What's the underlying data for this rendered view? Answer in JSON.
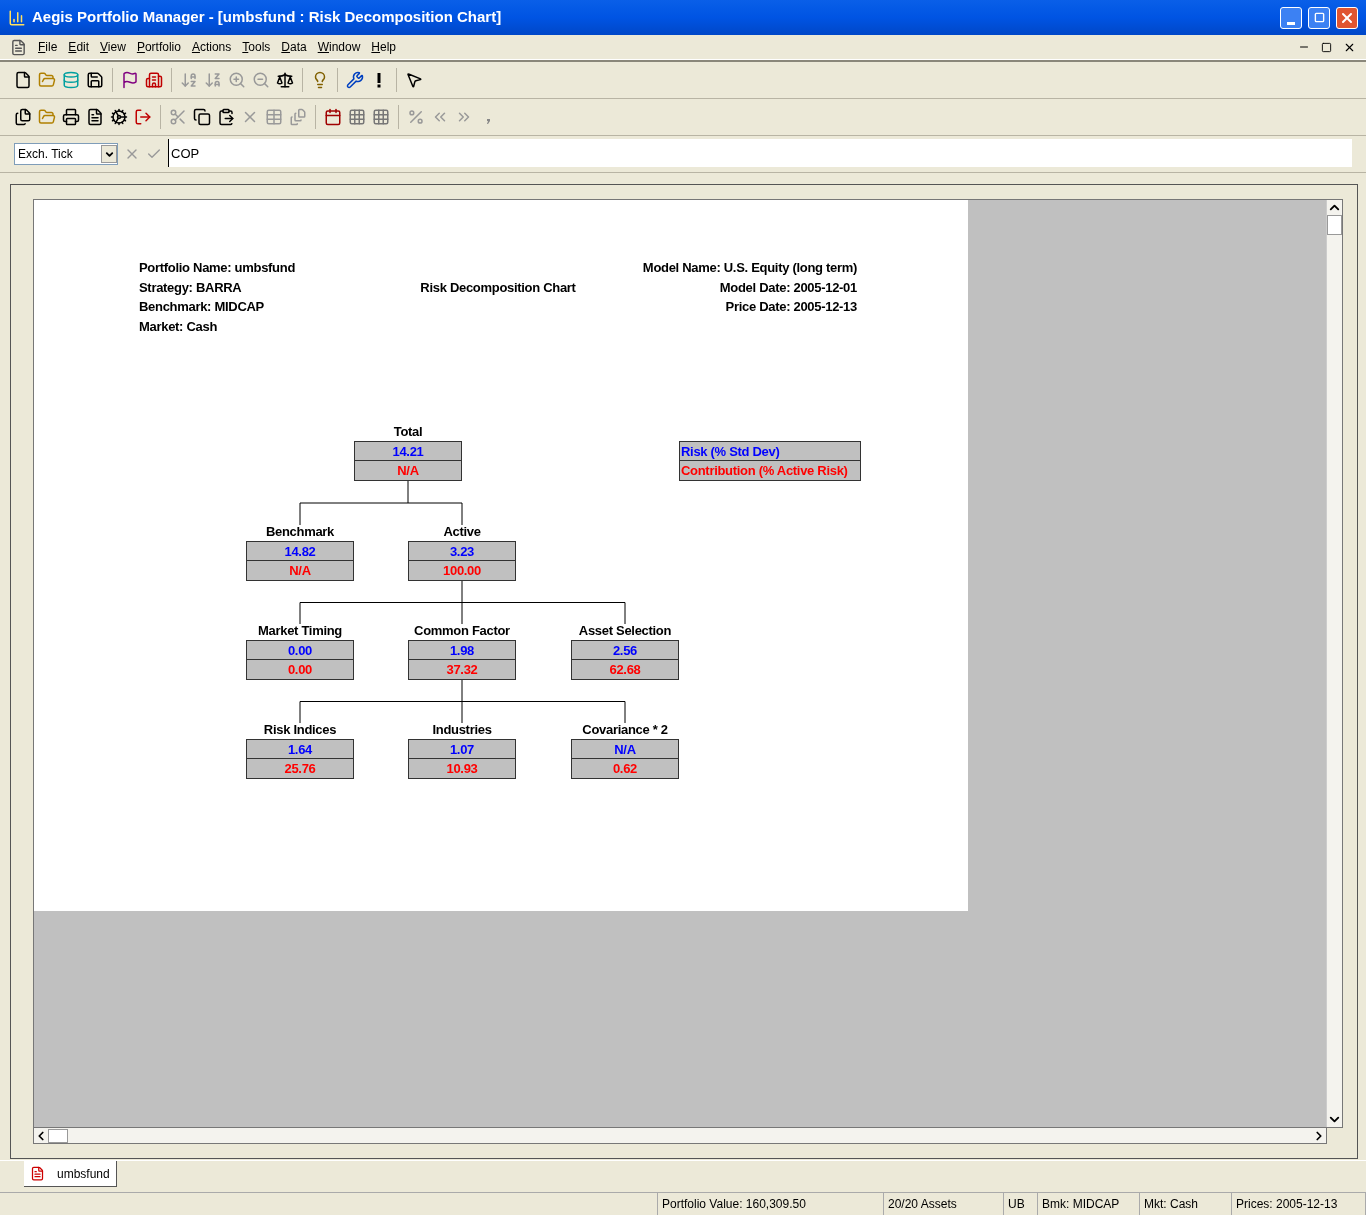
{
  "window": {
    "title": "Aegis Portfolio Manager - [umbsfund : Risk Decomposition Chart]"
  },
  "menu": [
    {
      "label": "File"
    },
    {
      "label": "Edit"
    },
    {
      "label": "View"
    },
    {
      "label": "Portfolio"
    },
    {
      "label": "Actions"
    },
    {
      "label": "Tools"
    },
    {
      "label": "Data"
    },
    {
      "label": "Window"
    },
    {
      "label": "Help"
    }
  ],
  "formula_bar": {
    "field": "Exch. Tick",
    "value": "COP"
  },
  "report": {
    "header_left": [
      "Portfolio Name: umbsfund",
      "Strategy: BARRA",
      "Benchmark: MIDCAP",
      "Market: Cash"
    ],
    "title": "Risk Decomposition Chart",
    "header_right": [
      "Model Name: U.S. Equity (long term)",
      "Model Date: 2005-12-01",
      "Price Date: 2005-12-13"
    ],
    "legend": {
      "risk_label": "Risk (% Std Dev)",
      "contribution_label": "Contribution (% Active Risk)"
    },
    "tree": {
      "label": "Total",
      "risk": "14.21",
      "contribution": "N/A",
      "children": [
        {
          "label": "Benchmark",
          "risk": "14.82",
          "contribution": "N/A"
        },
        {
          "label": "Active",
          "risk": "3.23",
          "contribution": "100.00",
          "children": [
            {
              "label": "Market Timing",
              "risk": "0.00",
              "contribution": "0.00"
            },
            {
              "label": "Common Factor",
              "risk": "1.98",
              "contribution": "37.32",
              "children": [
                {
                  "label": "Risk Indices",
                  "risk": "1.64",
                  "contribution": "25.76"
                },
                {
                  "label": "Industries",
                  "risk": "1.07",
                  "contribution": "10.93"
                },
                {
                  "label": "Covariance * 2",
                  "risk": "N/A",
                  "contribution": "0.62"
                }
              ]
            },
            {
              "label": "Asset Selection",
              "risk": "2.56",
              "contribution": "62.68"
            }
          ]
        }
      ]
    }
  },
  "tabs": [
    {
      "label": "umbsfund",
      "selected": true
    }
  ],
  "status_bar": [
    "Portfolio Value: 160,309.50",
    "20/20 Assets",
    "UB",
    "Bmk: MIDCAP",
    "Mkt: Cash",
    "Prices: 2005-12-13"
  ]
}
